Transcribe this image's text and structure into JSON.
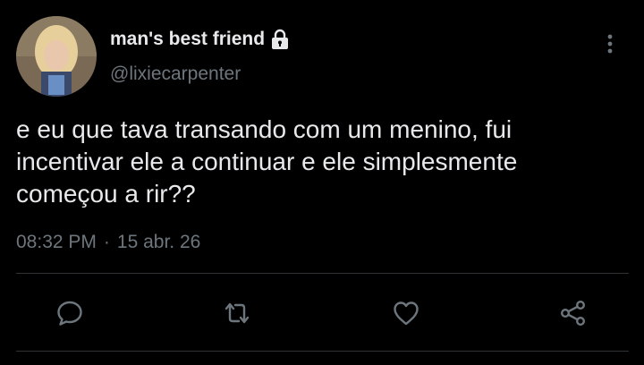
{
  "tweet": {
    "display_name": "man's best friend",
    "handle": "@lixiecarpenter",
    "text": "e eu que tava transando com um menino, fui\nincentivar ele a continuar e ele simplesmente\ncomeçou a rir??",
    "time": "08:32 PM",
    "date": "15 abr. 26",
    "separator": "·",
    "protected": true
  },
  "actions": [
    {
      "name": "reply",
      "icon": "comment-icon"
    },
    {
      "name": "retweet",
      "icon": "retweet-icon"
    },
    {
      "name": "like",
      "icon": "heart-icon"
    },
    {
      "name": "share",
      "icon": "share-icon"
    }
  ],
  "colors": {
    "background": "#000000",
    "primary_text": "#e7e9ea",
    "secondary_text": "#6e767d",
    "icon": "#6e767d",
    "divider": "#2f3336"
  }
}
